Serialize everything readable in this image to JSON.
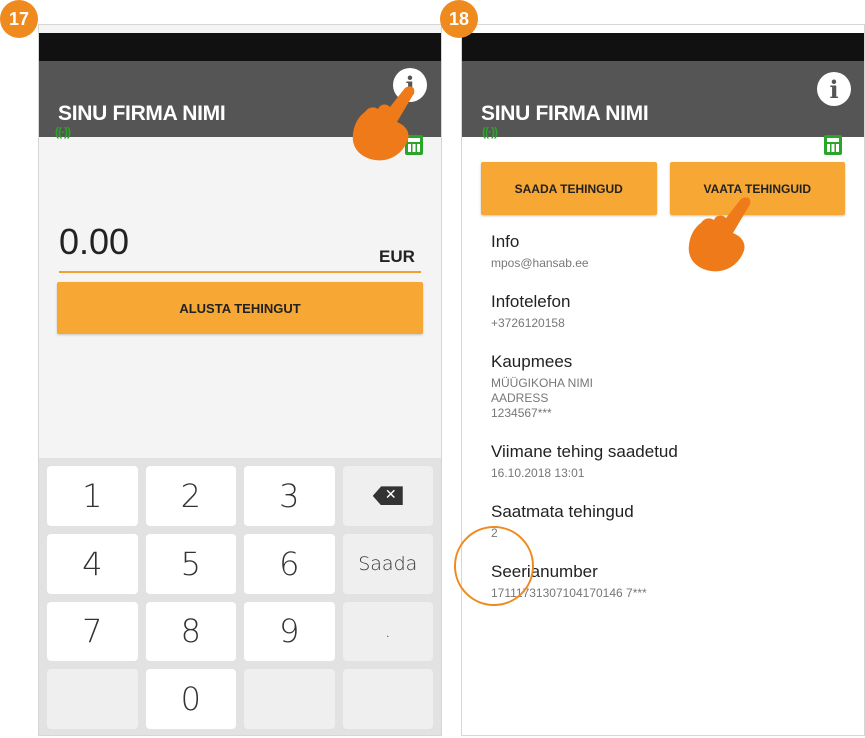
{
  "steps": {
    "left": "17",
    "right": "18"
  },
  "app": {
    "title": "SINU FIRMA NIMI",
    "info_glyph": "i",
    "signal_glyph": "((·))"
  },
  "payment": {
    "amount": "0.00",
    "currency": "EUR",
    "start_button": "ALUSTA TEHINGUT"
  },
  "keypad": {
    "keys": [
      "1",
      "2",
      "3",
      "backspace",
      "4",
      "5",
      "6",
      "Saada",
      "7",
      "8",
      "9",
      ".",
      "",
      "0",
      "",
      ""
    ],
    "backspace_glyph": "✕"
  },
  "actions": {
    "send": "SAADA TEHINGUD",
    "view": "VAATA TEHINGUID"
  },
  "info": {
    "items": [
      {
        "label": "Info",
        "value": "mpos@hansab.ee"
      },
      {
        "label": "Infotelefon",
        "value": "+3726120158"
      },
      {
        "label": "Kaupmees",
        "value": "MÜÜGIKOHA NIMI\nAADRESS\n1234567***"
      },
      {
        "label": "Viimane tehing saadetud",
        "value": "16.10.2018 13:01"
      },
      {
        "label": "Saatmata tehingud",
        "value": "2"
      },
      {
        "label": "Seerianumber",
        "value": "17111731307104170146 7***"
      }
    ]
  },
  "icons": {
    "info": "info-icon",
    "signal": "signal-icon",
    "calculator": "calculator-icon",
    "backspace": "backspace-icon",
    "hand": "hand-pointer-icon"
  },
  "colors": {
    "accent": "#f7a733",
    "badge": "#ef8a1f",
    "appbar": "#555555",
    "statusbar": "#111111",
    "signal_green": "#2aa52a"
  }
}
